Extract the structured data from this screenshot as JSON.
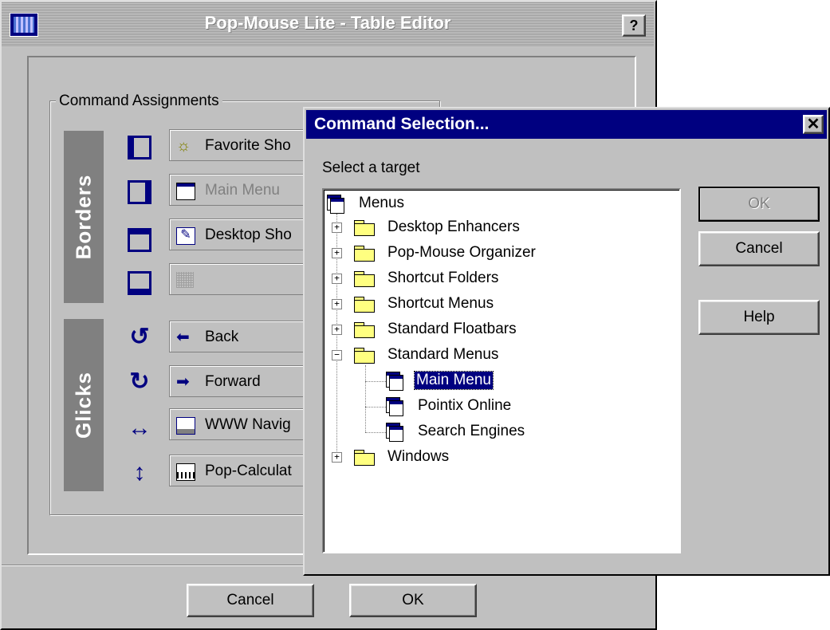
{
  "main_window": {
    "title": "Pop-Mouse Lite - Table Editor",
    "help_label": "?",
    "group_label": "Command Assignments",
    "borders_label": "Borders",
    "glicks_label": "Glicks",
    "assignments": [
      {
        "label": "Favorite Sho",
        "icon": "sun-icon",
        "enabled": true
      },
      {
        "label": "Main Menu",
        "icon": "menu-icon",
        "enabled": false
      },
      {
        "label": "Desktop Sho",
        "icon": "shortcut-icon",
        "enabled": true
      },
      {
        "label": "",
        "icon": "dotted-grid-icon",
        "enabled": false
      },
      {
        "label": "Back",
        "icon": "arrow-left-icon",
        "enabled": true
      },
      {
        "label": "Forward",
        "icon": "arrow-right-icon",
        "enabled": true
      },
      {
        "label": "WWW Navig",
        "icon": "keyboard-icon",
        "enabled": true
      },
      {
        "label": "Pop-Calculat",
        "icon": "calculator-icon",
        "enabled": true
      }
    ],
    "cancel_label": "Cancel",
    "ok_label": "OK"
  },
  "dialog": {
    "title": "Command Selection...",
    "close_label": "✕",
    "prompt": "Select a target",
    "ok_label": "OK",
    "cancel_label": "Cancel",
    "help_label": "Help",
    "tree": {
      "root": "Menus",
      "folders": [
        "Desktop Enhancers",
        "Pop-Mouse Organizer",
        "Shortcut Folders",
        "Shortcut Menus",
        "Standard Floatbars",
        "Standard Menus"
      ],
      "children": [
        "Main Menu",
        "Pointix Online",
        "Search Engines"
      ],
      "last_folder": "Windows",
      "selected": "Main Menu"
    }
  },
  "colors": {
    "face": "#c0c0c0",
    "title_active": "#000080",
    "band": "#808080"
  }
}
